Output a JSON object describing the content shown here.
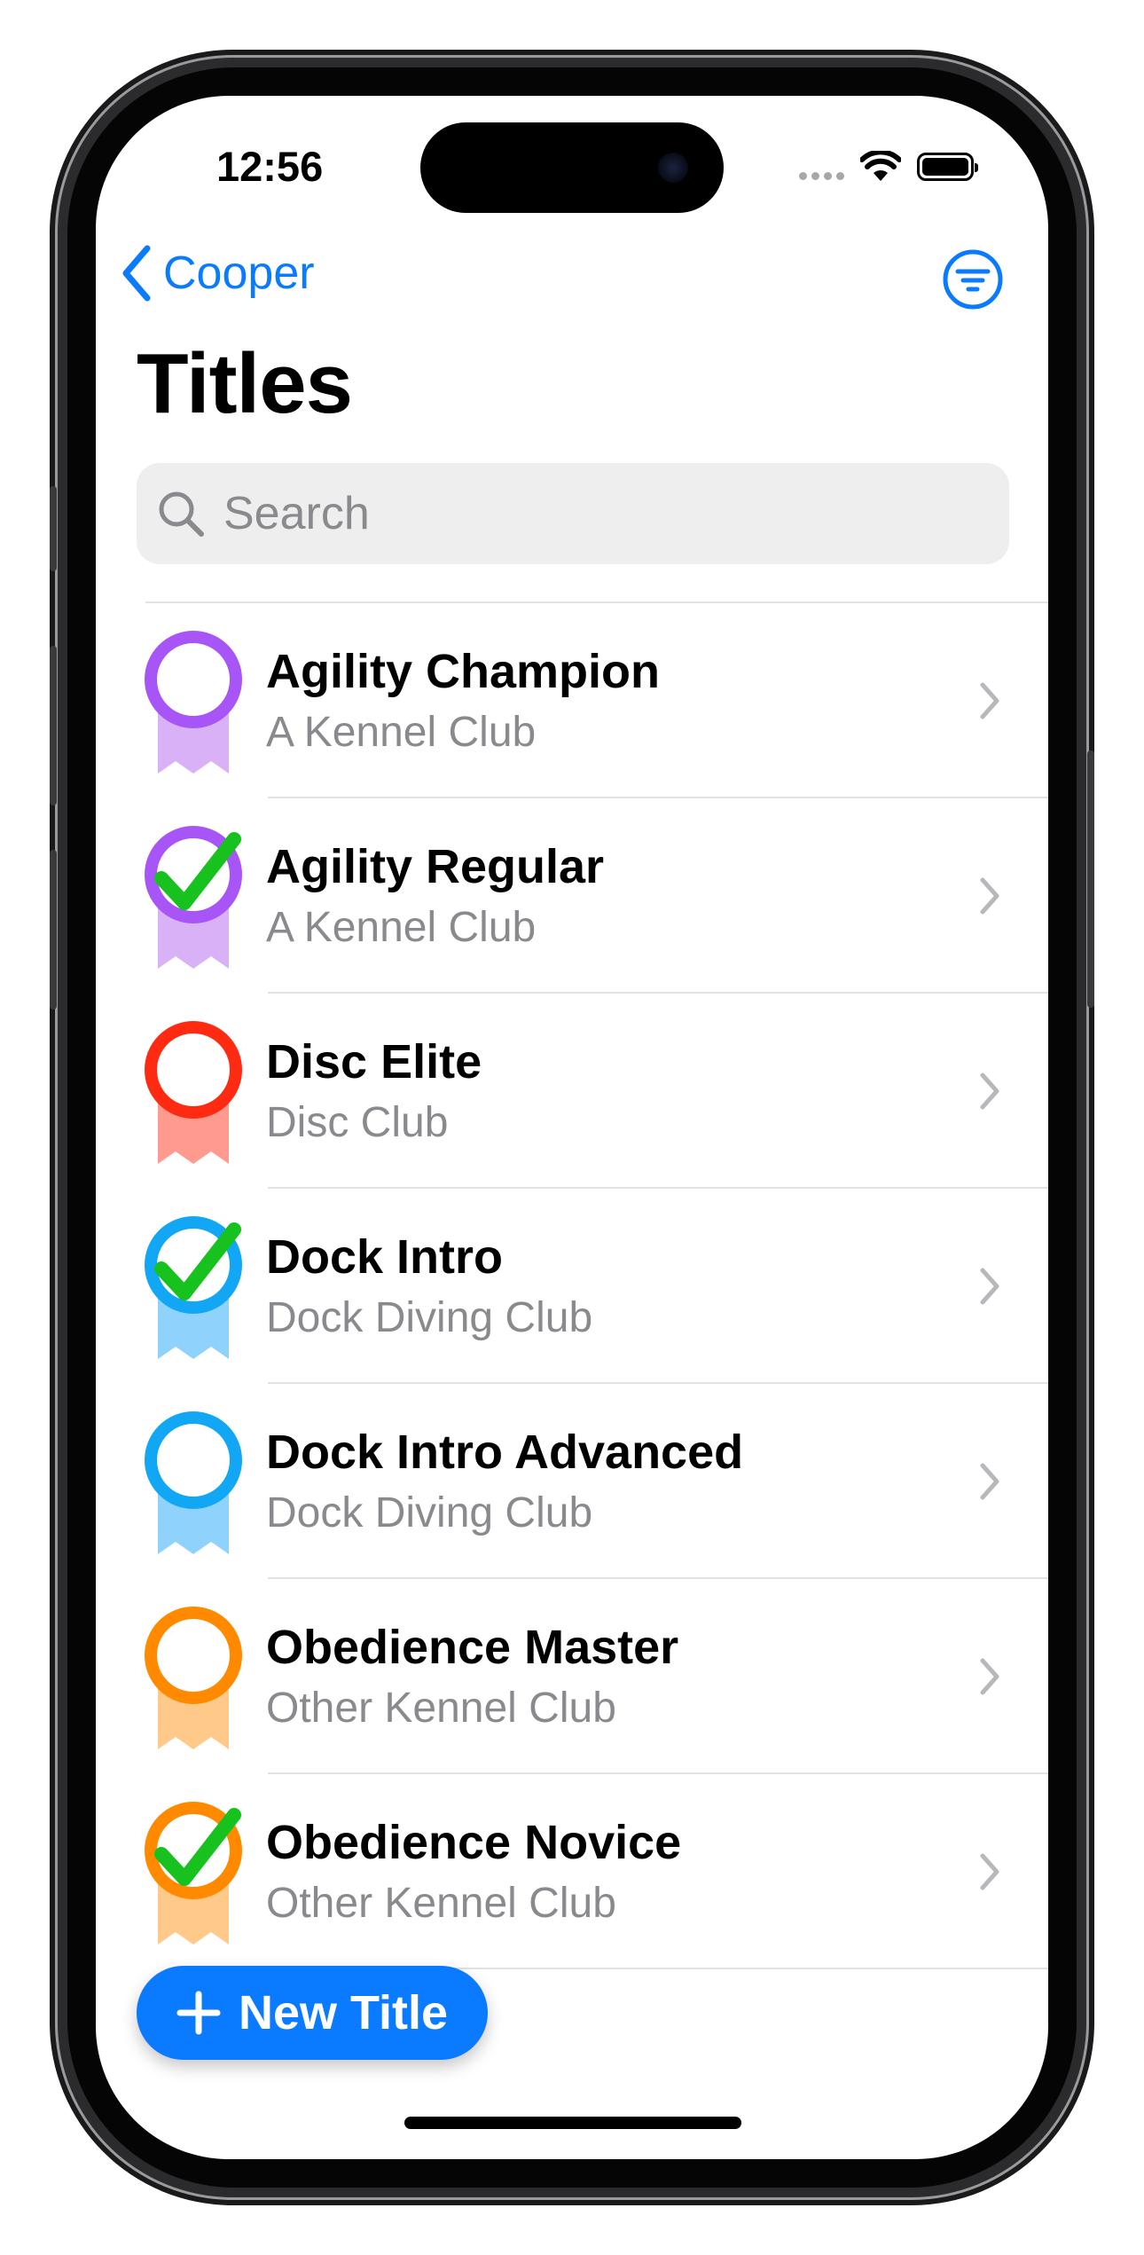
{
  "status_bar": {
    "time": "12:56",
    "icons": [
      "cellular-dots-icon",
      "wifi-icon",
      "battery-icon"
    ]
  },
  "nav": {
    "back_label": "Cooper",
    "back_icon": "chevron-left-icon",
    "filter_icon": "filter-icon",
    "accent_color": "#0A7AFF"
  },
  "page": {
    "title": "Titles"
  },
  "search": {
    "placeholder": "Search",
    "value": "",
    "icon": "search-icon"
  },
  "titles": [
    {
      "name": "Agility Champion",
      "club": "A Kennel Club",
      "earned": false,
      "color": "#A855F7",
      "ribbon_color": "#D9B1F6"
    },
    {
      "name": "Agility Regular",
      "club": "A Kennel Club",
      "earned": true,
      "color": "#A855F7",
      "ribbon_color": "#D9B1F6"
    },
    {
      "name": "Disc Elite",
      "club": "Disc Club",
      "earned": false,
      "color": "#FF2A12",
      "ribbon_color": "#FF9A8E"
    },
    {
      "name": "Dock Intro",
      "club": "Dock Diving Club",
      "earned": true,
      "color": "#11A7F5",
      "ribbon_color": "#8FD2FB"
    },
    {
      "name": "Dock Intro Advanced",
      "club": "Dock Diving Club",
      "earned": false,
      "color": "#11A7F5",
      "ribbon_color": "#8FD2FB"
    },
    {
      "name": "Obedience Master",
      "club": "Other Kennel Club",
      "earned": false,
      "color": "#FF8A00",
      "ribbon_color": "#FFC98A"
    },
    {
      "name": "Obedience Novice",
      "club": "Other Kennel Club",
      "earned": true,
      "color": "#FF8A00",
      "ribbon_color": "#FFC98A"
    }
  ],
  "check_color": "#18C21E",
  "new_button": {
    "label": "New Title",
    "icon": "plus-icon"
  }
}
